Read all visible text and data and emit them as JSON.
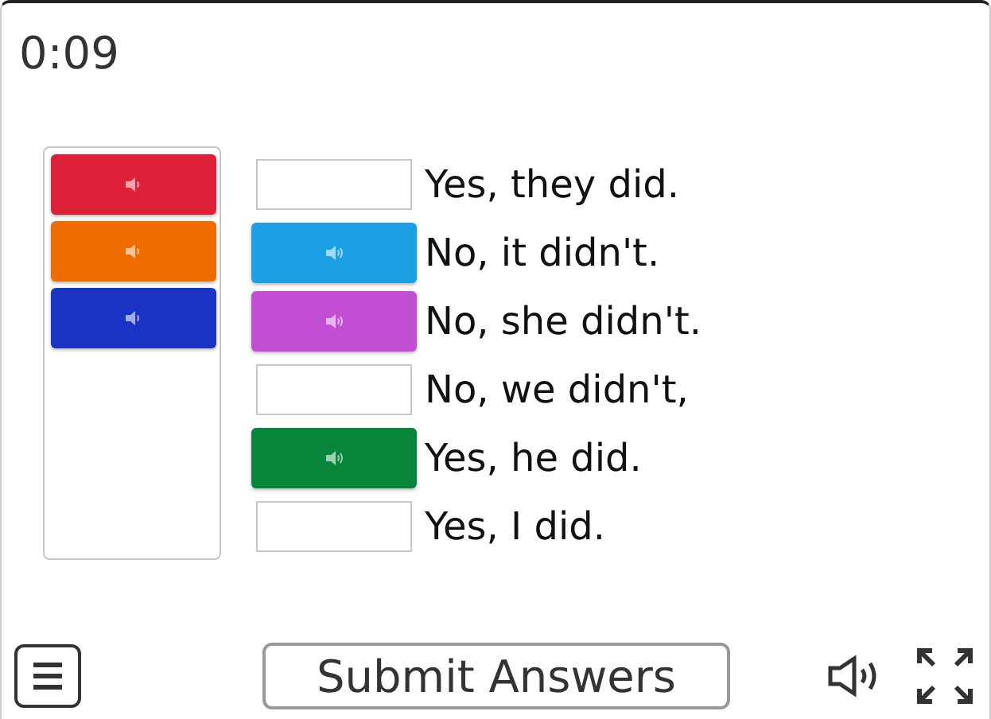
{
  "timer": "0:09",
  "bank": [
    {
      "color": "#dc2038"
    },
    {
      "color": "#ef6c00"
    },
    {
      "color": "#1a33c4"
    }
  ],
  "answers": [
    {
      "text": "Yes, they did."
    },
    {
      "text": "No, it didn't.",
      "tile": {
        "color": "#1d9fe3"
      }
    },
    {
      "text": "No, she didn't.",
      "tile": {
        "color": "#c24fd3"
      }
    },
    {
      "text": "No, we didn't,"
    },
    {
      "text": "Yes, he did.",
      "tile": {
        "color": "#08853a"
      }
    },
    {
      "text": "Yes, I did."
    }
  ],
  "submit": "Submit Answers"
}
